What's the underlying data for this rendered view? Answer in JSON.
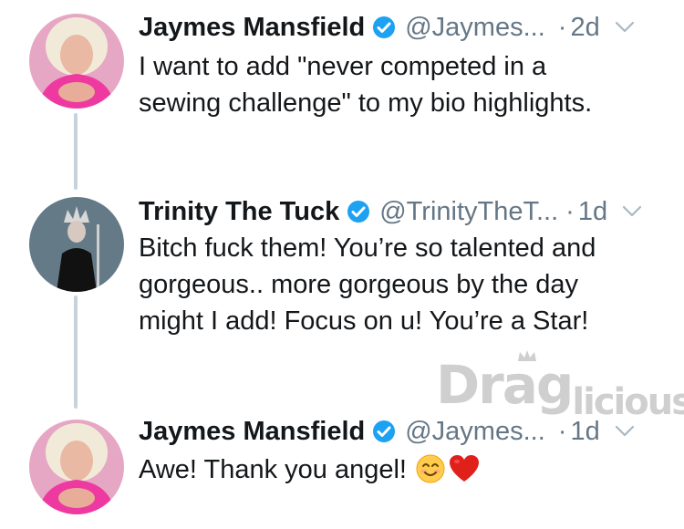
{
  "tweets": [
    {
      "name": "Jaymes Mansfield",
      "handle": "@Jaymes...",
      "time": "2d",
      "lines": [
        "I want to add \"never competed in a",
        "sewing challenge\" to my bio highlights."
      ]
    },
    {
      "name": "Trinity The Tuck",
      "handle": "@TrinityTheT...",
      "time": "1d",
      "lines": [
        "Bitch fuck them! You’re so talented and",
        "gorgeous.. more gorgeous by the day",
        "might I add! Focus on u! You’re a Star!"
      ]
    },
    {
      "name": "Jaymes Mansfield",
      "handle": "@Jaymes...",
      "time": "1d",
      "lines": [
        "Awe! Thank you angel!"
      ]
    }
  ],
  "dot": "·",
  "watermark": {
    "text_a": "Drag",
    "text_b": "licious"
  },
  "icons": {
    "verified": "verified-badge-icon",
    "chevron": "chevron-down-icon",
    "emoji_1": "smiling-face-emoji",
    "emoji_2": "red-heart-emoji"
  },
  "colors": {
    "text": "#14171a",
    "secondary": "#657786",
    "verified_blue": "#1da1f2",
    "thread_line": "#c7d3dc",
    "watermark": "#cfcfcf"
  }
}
